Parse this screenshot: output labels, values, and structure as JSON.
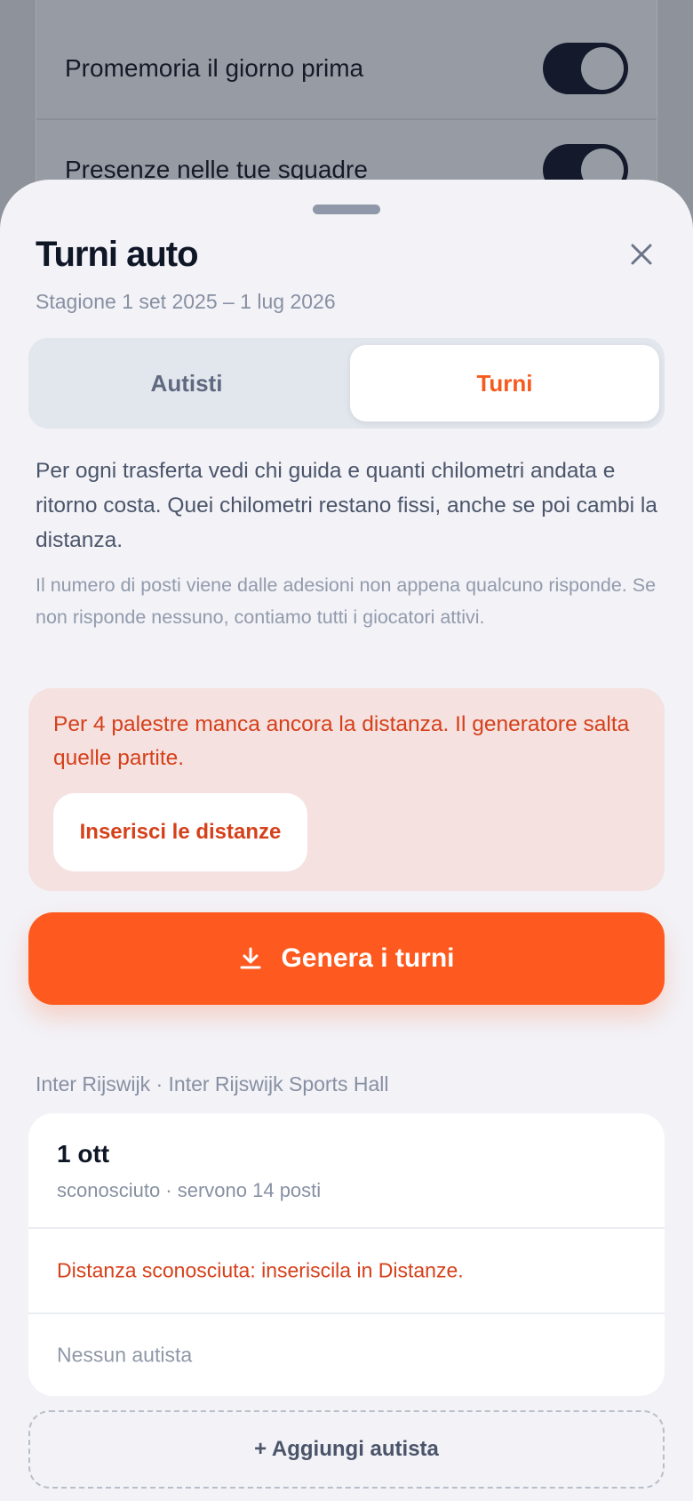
{
  "background": {
    "rows": [
      {
        "label": "Promemoria il giorno prima",
        "toggle_on": true
      },
      {
        "label": "Presenze nelle tue squadre",
        "toggle_on": true
      }
    ]
  },
  "sheet": {
    "title": "Turni auto",
    "subtitle": "Stagione 1 set 2025 – 1 lug 2026",
    "close_icon": "close-icon",
    "tabs": [
      {
        "label": "Autisti",
        "active": false
      },
      {
        "label": "Turni",
        "active": true
      }
    ],
    "description": "Per ogni trasferta vedi chi guida e quanti chilometri andata e ritorno costa. Quei chilometri restano fissi, anche se poi cambi la distanza.",
    "note": "Il numero di posti viene dalle adesioni non appena qualcuno risponde. Se non risponde nessuno, contiamo tutti i giocatori attivi.",
    "warning": {
      "text": "Per 4 palestre manca ancora la distanza. Il generatore salta quelle partite.",
      "button_label": "Inserisci le distanze"
    },
    "generate_button": {
      "label": "Genera i turni",
      "icon": "download-icon"
    },
    "section_label": "Inter Rijswijk · Inter Rijswijk Sports Hall",
    "match": {
      "date": "1 ott",
      "meta": "sconosciuto · servono 14 posti",
      "warning": "Distanza sconosciuta: inseriscila in Distanze.",
      "drivers": "Nessun autista"
    },
    "add_driver_label": "+ Aggiungi autista"
  },
  "colors": {
    "accent": "#fe5a1f",
    "warning_text": "#d6401a",
    "warning_bg": "#f4e1e0",
    "title": "#0f1626"
  }
}
